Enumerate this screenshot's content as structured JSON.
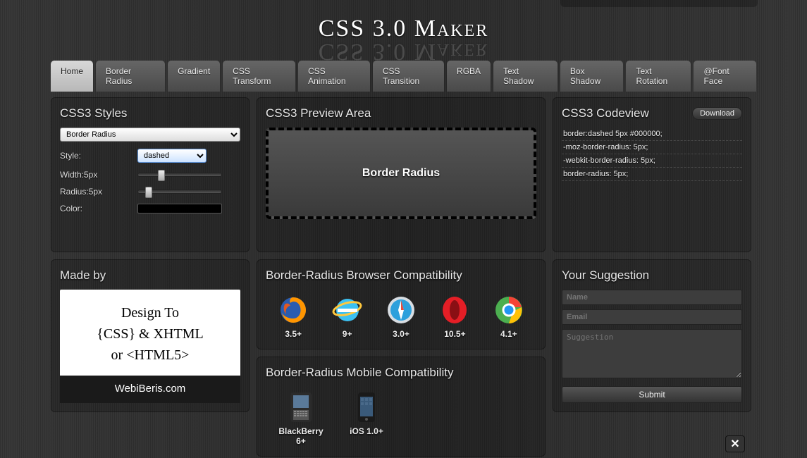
{
  "title": "CSS 3.0 Maker",
  "nav": [
    {
      "label": "Home",
      "active": true
    },
    {
      "label": "Border Radius",
      "active": false
    },
    {
      "label": "Gradient",
      "active": false
    },
    {
      "label": "CSS Transform",
      "active": false
    },
    {
      "label": "CSS Animation",
      "active": false
    },
    {
      "label": "CSS Transition",
      "active": false
    },
    {
      "label": "RGBA",
      "active": false
    },
    {
      "label": "Text Shadow",
      "active": false
    },
    {
      "label": "Box Shadow",
      "active": false
    },
    {
      "label": "Text Rotation",
      "active": false
    },
    {
      "label": "@Font Face",
      "active": false
    }
  ],
  "styles_panel": {
    "title": "CSS3 Styles",
    "select_value": "Border Radius",
    "style_label": "Style:",
    "style_value": "dashed",
    "width_label": "Width:5px",
    "radius_label": "Radius:5px",
    "color_label": "Color:",
    "color_value": "#000000"
  },
  "preview_panel": {
    "title": "CSS3 Preview Area",
    "text": "Border Radius"
  },
  "codeview_panel": {
    "title": "CSS3 Codeview",
    "download": "Download",
    "lines": [
      "border:dashed 5px #000000;",
      "-moz-border-radius: 5px;",
      "-webkit-border-radius: 5px;",
      "border-radius: 5px;"
    ]
  },
  "madeby_panel": {
    "title": "Made by",
    "line1": "Design To",
    "line2": "{CSS} & XHTML",
    "line3": "or  <HTML5>",
    "footer": "WebiBeris.com"
  },
  "browser_compat": {
    "title": "Border-Radius Browser Compatibility",
    "items": [
      {
        "name": "firefox",
        "label": "3.5+"
      },
      {
        "name": "ie",
        "label": "9+"
      },
      {
        "name": "safari",
        "label": "3.0+"
      },
      {
        "name": "opera",
        "label": "10.5+"
      },
      {
        "name": "chrome",
        "label": "4.1+"
      }
    ]
  },
  "mobile_compat": {
    "title": "Border-Radius Mobile Compatibility",
    "items": [
      {
        "name": "blackberry",
        "label": "BlackBerry 6+"
      },
      {
        "name": "ios",
        "label": "iOS 1.0+"
      }
    ]
  },
  "suggestion_panel": {
    "title": "Your Suggestion",
    "name_placeholder": "Name",
    "email_placeholder": "Email",
    "suggestion_placeholder": "Suggestion",
    "submit": "Submit"
  },
  "close_icon": "✕"
}
